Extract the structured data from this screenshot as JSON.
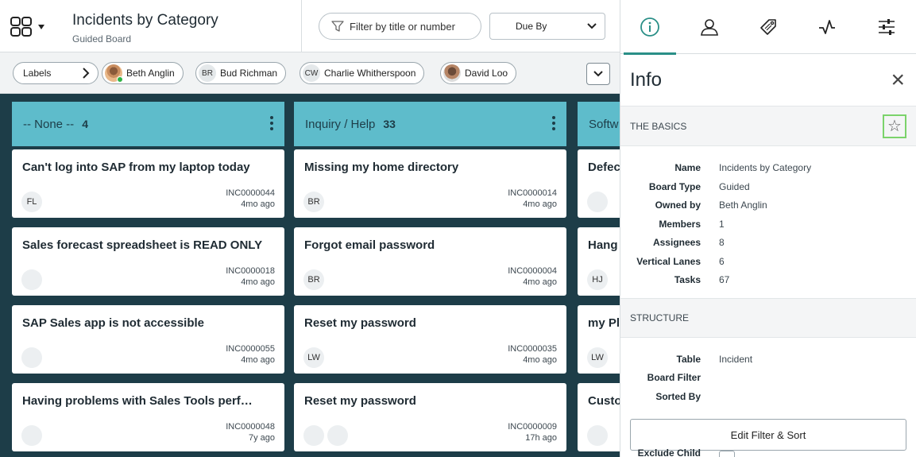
{
  "header": {
    "title": "Incidents by Category",
    "subtitle": "Guided Board",
    "filter_placeholder": "Filter by title or number",
    "due_by": "Due By"
  },
  "labels_row": {
    "labels_label": "Labels",
    "members": [
      {
        "name": "Beth Anglin",
        "initials": "",
        "photo": true,
        "online": true
      },
      {
        "name": "Bud Richman",
        "initials": "BR",
        "photo": false
      },
      {
        "name": "Charlie Whitherspoon",
        "initials": "CW",
        "photo": false
      },
      {
        "name": "David Loo",
        "initials": "",
        "photo": true
      }
    ]
  },
  "lanes": [
    {
      "title": "-- None --",
      "count": "4",
      "cards": [
        {
          "title": "Can't log into SAP from my laptop today",
          "number": "INC0000044",
          "age": "4mo ago",
          "avatar": "FL"
        },
        {
          "title": "Sales forecast spreadsheet is READ ONLY",
          "number": "INC0000018",
          "age": "4mo ago",
          "avatar": ""
        },
        {
          "title": "SAP Sales app is not accessible",
          "number": "INC0000055",
          "age": "4mo ago",
          "avatar": ""
        },
        {
          "title": "Having problems with Sales Tools perf…",
          "number": "INC0000048",
          "age": "7y ago",
          "avatar": ""
        }
      ]
    },
    {
      "title": "Inquiry / Help",
      "count": "33",
      "cards": [
        {
          "title": "Missing my home directory",
          "number": "INC0000014",
          "age": "4mo ago",
          "avatar": "BR"
        },
        {
          "title": "Forgot email password",
          "number": "INC0000004",
          "age": "4mo ago",
          "avatar": "BR"
        },
        {
          "title": "Reset my password",
          "number": "INC0000035",
          "age": "4mo ago",
          "avatar": "LW"
        },
        {
          "title": "Reset my password",
          "number": "INC0000009",
          "age": "17h ago",
          "avatar": ""
        }
      ]
    },
    {
      "title": "Softw",
      "cards": [
        {
          "title": "Defec",
          "avatar": ""
        },
        {
          "title": "Hang",
          "avatar": "HJ"
        },
        {
          "title": "my Pl",
          "avatar": "LW"
        },
        {
          "title": "Custo",
          "avatar": ""
        }
      ]
    }
  ],
  "panel": {
    "tabs": [
      "info-icon",
      "user-icon",
      "tag-icon",
      "activity-icon",
      "sliders-icon"
    ],
    "title": "Info",
    "basics_heading": "THE BASICS",
    "basics": [
      {
        "k": "Name",
        "v": "Incidents by Category"
      },
      {
        "k": "Board Type",
        "v": "Guided"
      },
      {
        "k": "Owned by",
        "v": "Beth Anglin"
      },
      {
        "k": "Members",
        "v": "1"
      },
      {
        "k": "Assignees",
        "v": "8"
      },
      {
        "k": "Vertical Lanes",
        "v": "6"
      },
      {
        "k": "Tasks",
        "v": "67"
      }
    ],
    "structure_heading": "STRUCTURE",
    "structure": [
      {
        "k": "Table",
        "v": "Incident"
      },
      {
        "k": "Board Filter",
        "v": ""
      },
      {
        "k": "Sorted By",
        "v": ""
      }
    ],
    "edit_button": "Edit Filter & Sort",
    "exclude_label": "Exclude Child"
  },
  "colors": {
    "board_bg": "#1d3d48",
    "lane_header": "#5ebccb",
    "accent": "#2a8f87",
    "highlight": "#7bd36b"
  }
}
